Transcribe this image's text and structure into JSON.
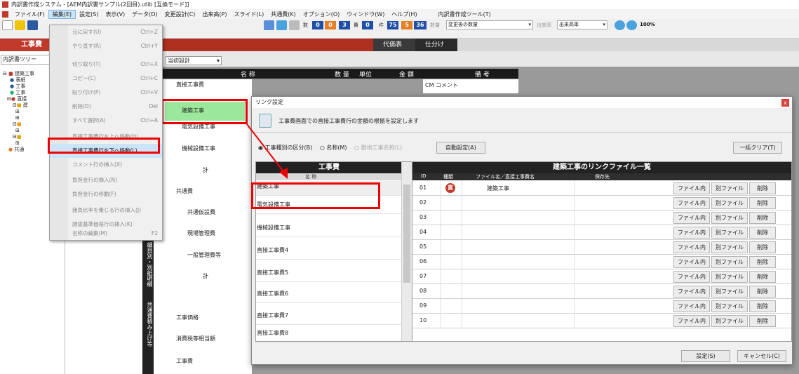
{
  "title": "内訳書作成システム - [AEM内訳書サンプル(2回目).utib [互換モード]]",
  "menu": [
    "ファイル(F)",
    "編集(E)",
    "設定(S)",
    "表示(V)",
    "データ(D)",
    "変更設計(C)",
    "出来高(P)",
    "スライド(L)",
    "共通費(K)",
    "オプション(O)",
    "ウィンドウ(W)",
    "ヘルプ(H)",
    "内訳書作成ツール(T)"
  ],
  "toolbar": {
    "counts": [
      "0",
      "0",
      "3",
      "0",
      "75",
      "5",
      "36"
    ],
    "count_label_kazu": "数",
    "count_label_hi": "費",
    "count_label_ken": "件",
    "sel_label": "数量",
    "sel_value": "変更後の数量",
    "dk_label": "出来高",
    "dk_value": "出来高率",
    "zoom": "100%"
  },
  "tabs": {
    "left": "工事費",
    "price": "代価表",
    "split": "仕分け"
  },
  "left": {
    "combo": "内訳書ツリー",
    "tree": [
      "建築工事",
      "表紙",
      "工事",
      "工事",
      "直接",
      "建",
      "共通"
    ]
  },
  "subbar": {
    "combo": "当初設計"
  },
  "grid_header": {
    "name": "名 称",
    "qty": "数 量",
    "unit": "単位",
    "amount": "金 額",
    "note": "備 考"
  },
  "col_rows": [
    "直接工事費",
    "建築工事",
    "電気設備工事",
    "機械設備工事",
    "計",
    "共通費",
    "共通仮設費",
    "現場管理費",
    "一般管理費等",
    "計",
    "工事価格",
    "消費税等相当額",
    "工事費"
  ],
  "col_note": "CM コメント",
  "vband": {
    "t1": "細目別・別紙明細",
    "t2": "共通費積み上げ等"
  },
  "ctx": [
    {
      "label": "元に戻す(U)",
      "sc": "Ctrl+Z",
      "on": false
    },
    {
      "label": "やり直す(R)",
      "sc": "Ctrl+Y",
      "on": false
    },
    {
      "label": "切り取り(T)",
      "sc": "Ctrl+X",
      "on": false
    },
    {
      "label": "コピー(C)",
      "sc": "Ctrl+C",
      "on": false
    },
    {
      "label": "貼り付け(P)",
      "sc": "Ctrl+V",
      "on": false
    },
    {
      "label": "削除(D)",
      "sc": "Del",
      "on": false
    },
    {
      "label": "すべて選択(A)",
      "sc": "Ctrl+A",
      "on": false
    },
    {
      "label": "直接工事費行を上へ移動(H)",
      "sc": "",
      "on": false
    },
    {
      "label": "直接工事費行を下へ移動(L)",
      "sc": "",
      "on": true
    },
    {
      "label": "コメント行の挿入(X)",
      "sc": "",
      "on": false
    },
    {
      "label": "負担金行の挿入(N)",
      "sc": "",
      "on": false
    },
    {
      "label": "負担金行の移動(F)",
      "sc": "",
      "on": false
    },
    {
      "label": "諸負比率を乗じる行の挿入(J)",
      "sc": "",
      "on": false
    },
    {
      "label": "調査基準価格行の挿入(K)",
      "sc": "",
      "on": false
    },
    {
      "label": "名称の編集(M)",
      "sc": "F2",
      "on": false
    }
  ],
  "dialog": {
    "title": "リンク設定",
    "desc": "工事費画面での直接工事費行の金額の根拠を設定します",
    "radio1": "工事種別の区分(B)",
    "radio2": "名称(M)",
    "radio3": "敷地工事名称(L)",
    "auto": "自動設定(A)",
    "clear": "一括クリア(T)",
    "left_header": "工事費",
    "left_sub": "名 称",
    "left_rows": [
      "建築工事",
      "電気設備工事",
      "機械設備工事",
      "直接工事費4",
      "直接工事費5",
      "直接工事費6",
      "直接工事費7",
      "直接工事費8"
    ],
    "right_header": "建築工事のリンクファイル一覧",
    "right_cols": {
      "id": "ID",
      "kind": "種類",
      "file": "ファイル名／直接工事費名",
      "save": "保存先"
    },
    "right_rows": [
      {
        "id": "01",
        "kind": "直",
        "name": "建築工事"
      },
      {
        "id": "02",
        "kind": "",
        "name": ""
      },
      {
        "id": "03",
        "kind": "",
        "name": ""
      },
      {
        "id": "04",
        "kind": "",
        "name": ""
      },
      {
        "id": "05",
        "kind": "",
        "name": ""
      },
      {
        "id": "06",
        "kind": "",
        "name": ""
      },
      {
        "id": "07",
        "kind": "",
        "name": ""
      },
      {
        "id": "08",
        "kind": "",
        "name": ""
      },
      {
        "id": "09",
        "kind": "",
        "name": ""
      },
      {
        "id": "10",
        "kind": "",
        "name": ""
      }
    ],
    "btn_in": "ファイル内",
    "btn_other": "別ファイル",
    "btn_del": "削除",
    "ok": "設定(S)",
    "cancel": "キャンセル(C)"
  },
  "colors": {
    "accent": "#c0392b",
    "highlight": "#e00000",
    "selgreen": "#9be79b"
  }
}
